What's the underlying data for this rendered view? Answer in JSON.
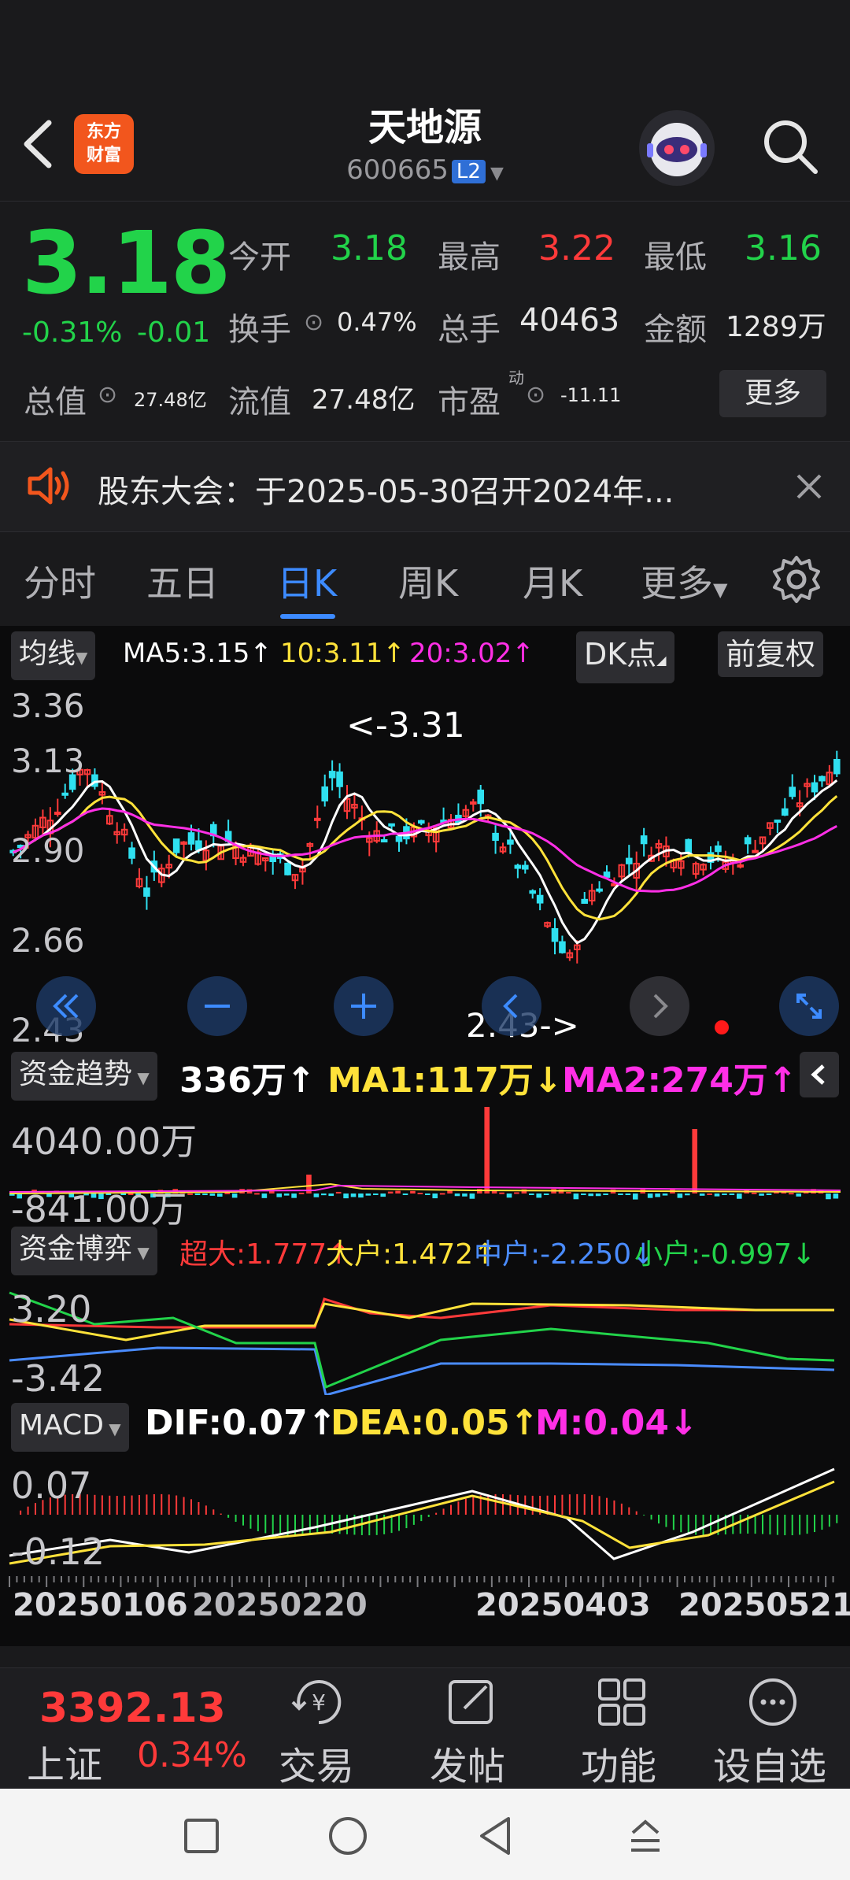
{
  "header": {
    "title": "天地源",
    "code": "600665",
    "level_badge": "L2",
    "logo_text_line1": "东方",
    "logo_text_line2": "财富"
  },
  "quote": {
    "price": "3.18",
    "change_pct": "-0.31%",
    "change": "-0.01",
    "open_label": "今开",
    "open": "3.18",
    "high_label": "最高",
    "high": "3.22",
    "low_label": "最低",
    "low": "3.16",
    "turnover_label": "换手",
    "turnover": "0.47%",
    "volume_label": "总手",
    "volume": "40463",
    "amount_label": "金额",
    "amount": "1289万",
    "total_cap_label": "总值",
    "total_cap": "27.48亿",
    "float_cap_label": "流值",
    "float_cap": "27.48亿",
    "pe_label": "市盈",
    "pe_sup": "动",
    "pe": "-11.11",
    "more_button": "更多"
  },
  "notice": {
    "text": "股东大会：于2025-05-30召开2024年..."
  },
  "tabs": [
    "分时",
    "五日",
    "日K",
    "周K",
    "月K",
    "更多"
  ],
  "kline": {
    "indicator_select": "均线",
    "ma5": "MA5:3.15↑",
    "ma10": "10:3.11↑",
    "ma20": "20:3.02↑",
    "dk_button": "DK点",
    "adjust_button": "前复权",
    "y_labels": [
      "3.36",
      "3.13",
      "2.90",
      "2.66",
      "2.43"
    ],
    "high_marker": "<-3.31",
    "low_marker": "2.43->"
  },
  "fund_trend": {
    "select": "资金趋势",
    "value": "336万↑",
    "ma1": "MA1:117万↓",
    "ma2": "MA2:274万↑",
    "y_top": "4040.00万",
    "y_bottom": "-841.00万"
  },
  "fund_game": {
    "select": "资金博弈",
    "super": "超大:1.777↑",
    "large": "大户:1.472↑",
    "mid": "中户:-2.250↓",
    "small": "小户:-0.997↓",
    "y_top": "3.20",
    "y_bottom": "-3.42"
  },
  "macd": {
    "select": "MACD",
    "dif": "DIF:0.07↑",
    "dea": "DEA:0.05↑",
    "m": "M:0.04↓",
    "y_top": "0.07",
    "y_bottom": "-0.12"
  },
  "dates": [
    "20250106",
    "20250220",
    "20250403",
    "20250521"
  ],
  "bottom_nav": {
    "index_value": "3392.13",
    "index_name": "上证",
    "index_change": "0.34%",
    "items": [
      "交易",
      "发帖",
      "功能",
      "设自选"
    ]
  },
  "colors": {
    "up": "#ff3a3a",
    "down": "#22d34a",
    "accent": "#3d8bff",
    "ma5": "#ffffff",
    "ma10": "#ffe23a",
    "ma20": "#ff2fe6"
  }
}
